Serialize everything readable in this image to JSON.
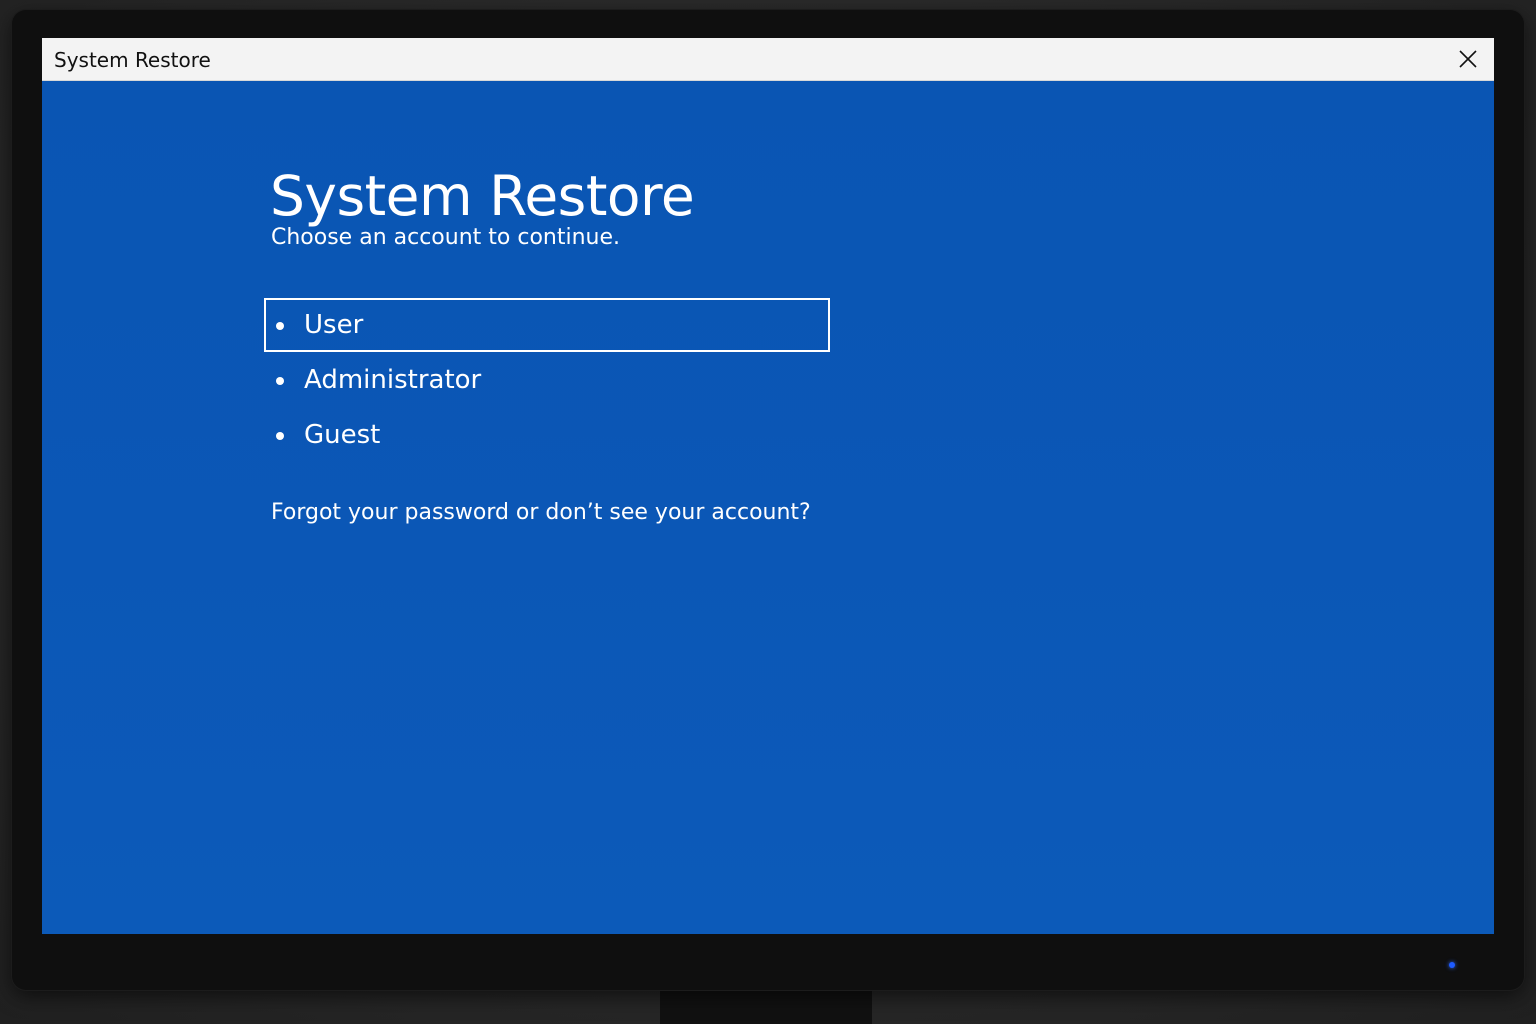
{
  "window": {
    "title": "System Restore",
    "close_icon": "close-icon"
  },
  "main": {
    "title": "System Restore",
    "subtitle": "Choose an account to continue.",
    "accounts": [
      {
        "label": "User",
        "selected": true
      },
      {
        "label": "Administrator",
        "selected": false
      },
      {
        "label": "Guest",
        "selected": false
      }
    ],
    "forgot_link": "Forgot your password or don’t see your account?"
  },
  "colors": {
    "background": "#0b55b5",
    "titlebar": "#f3f3f3",
    "text": "#ffffff",
    "power_led": "#1e5bff"
  }
}
